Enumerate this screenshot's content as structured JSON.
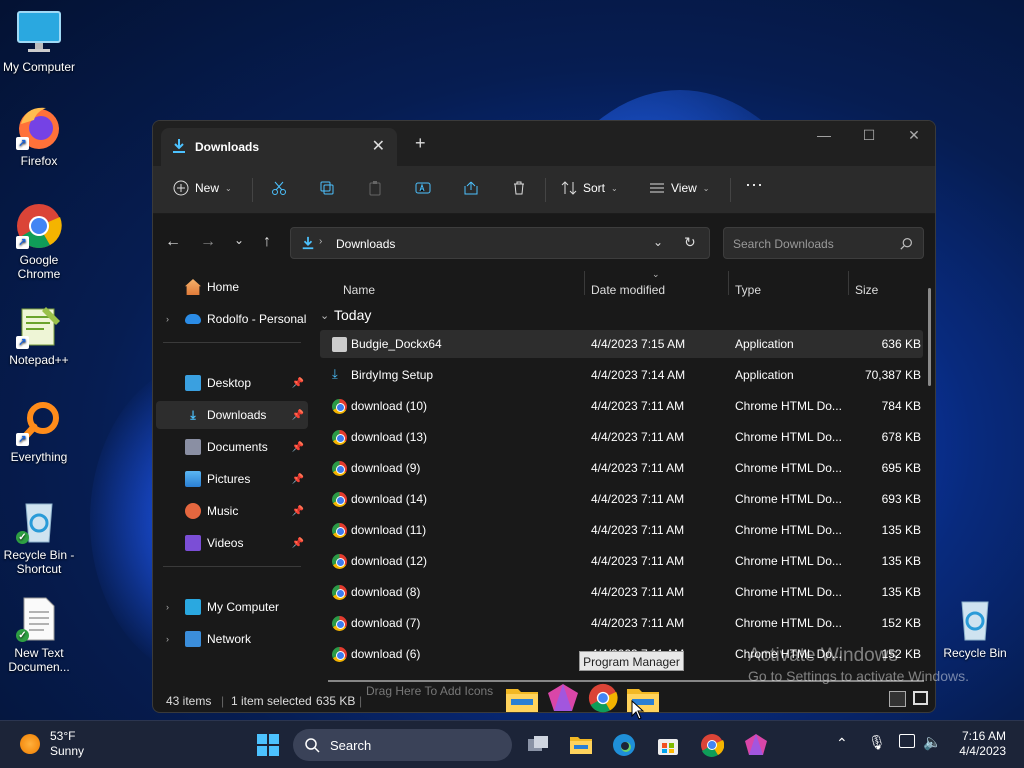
{
  "desktop": {
    "icons": [
      {
        "label": "My Computer"
      },
      {
        "label": "Firefox"
      },
      {
        "label": "Google Chrome"
      },
      {
        "label": "Notepad++"
      },
      {
        "label": "Everything"
      },
      {
        "label": "Recycle Bin - Shortcut"
      },
      {
        "label": "New Text Documen..."
      },
      {
        "label": "Recycle Bin"
      }
    ]
  },
  "explorer": {
    "tab_title": "Downloads",
    "toolbar": {
      "new": "New",
      "sort": "Sort",
      "view": "View"
    },
    "address": "Downloads",
    "search_placeholder": "Search Downloads",
    "sidebar": [
      {
        "label": "Home"
      },
      {
        "label": "Rodolfo - Personal"
      },
      {
        "label": "Desktop"
      },
      {
        "label": "Downloads"
      },
      {
        "label": "Documents"
      },
      {
        "label": "Pictures"
      },
      {
        "label": "Music"
      },
      {
        "label": "Videos"
      },
      {
        "label": "My Computer"
      },
      {
        "label": "Network"
      }
    ],
    "columns": {
      "name": "Name",
      "date": "Date modified",
      "type": "Type",
      "size": "Size"
    },
    "group": "Today",
    "files": [
      {
        "name": "Budgie_Dockx64",
        "date": "4/4/2023 7:15 AM",
        "type": "Application",
        "size": "636 KB"
      },
      {
        "name": "BirdyImg Setup",
        "date": "4/4/2023 7:14 AM",
        "type": "Application",
        "size": "70,387 KB"
      },
      {
        "name": "download (10)",
        "date": "4/4/2023 7:11 AM",
        "type": "Chrome HTML Do...",
        "size": "784 KB"
      },
      {
        "name": "download (13)",
        "date": "4/4/2023 7:11 AM",
        "type": "Chrome HTML Do...",
        "size": "678 KB"
      },
      {
        "name": "download (9)",
        "date": "4/4/2023 7:11 AM",
        "type": "Chrome HTML Do...",
        "size": "695 KB"
      },
      {
        "name": "download (14)",
        "date": "4/4/2023 7:11 AM",
        "type": "Chrome HTML Do...",
        "size": "693 KB"
      },
      {
        "name": "download (11)",
        "date": "4/4/2023 7:11 AM",
        "type": "Chrome HTML Do...",
        "size": "135 KB"
      },
      {
        "name": "download (12)",
        "date": "4/4/2023 7:11 AM",
        "type": "Chrome HTML Do...",
        "size": "135 KB"
      },
      {
        "name": "download (8)",
        "date": "4/4/2023 7:11 AM",
        "type": "Chrome HTML Do...",
        "size": "135 KB"
      },
      {
        "name": "download (7)",
        "date": "4/4/2023 7:11 AM",
        "type": "Chrome HTML Do...",
        "size": "152 KB"
      },
      {
        "name": "download (6)",
        "date": "4/4/2023 7:11 AM",
        "type": "Chrome HTML Do...",
        "size": "152 KB"
      }
    ],
    "status": {
      "count": "43 items",
      "selected": "1 item selected",
      "size": "635 KB"
    }
  },
  "dock": {
    "tooltip": "Program Manager",
    "hint": "Drag Here To Add Icons"
  },
  "watermark": {
    "title": "Activate Windows",
    "subtitle": "Go to Settings to activate Windows."
  },
  "taskbar": {
    "weather_temp": "53°F",
    "weather_desc": "Sunny",
    "search_label": "Search",
    "time": "7:16 AM",
    "date": "4/4/2023"
  },
  "colors": {
    "accent": "#4cc2ff",
    "selection": "#2d2d2d",
    "window_bg": "#191919"
  }
}
